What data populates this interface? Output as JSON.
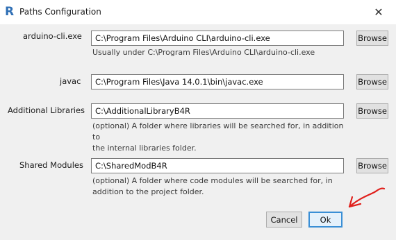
{
  "window": {
    "title": "Paths Configuration",
    "logo_text": "R",
    "close_glyph": "✕"
  },
  "rows": [
    {
      "label": "arduino-cli.exe",
      "value": "C:\\Program Files\\Arduino CLI\\arduino-cli.exe",
      "hint": [
        "Usually under C:\\Program Files\\Arduino CLI\\arduino-cli.exe"
      ],
      "browse_label": "Browse"
    },
    {
      "label": "javac",
      "value": "C:\\Program Files\\Java 14.0.1\\bin\\javac.exe",
      "hint": [],
      "browse_label": "Browse"
    },
    {
      "label": "Additional Libraries",
      "value": "C:\\AdditionalLibraryB4R",
      "hint": [
        "(optional) A folder where libraries will be searched for, in addition to",
        "the internal libraries folder."
      ],
      "browse_label": "Browse"
    },
    {
      "label": "Shared Modules",
      "value": "C:\\SharedModB4R",
      "hint": [
        "(optional) A folder where code modules will be searched for, in",
        "addition to the project folder."
      ],
      "browse_label": "Browse"
    }
  ],
  "footer": {
    "cancel_label": "Cancel",
    "ok_label": "Ok"
  },
  "colors": {
    "annotation_arrow": "#e0201c",
    "ok_border": "#3a8fd6",
    "logo": "#2f6fb5"
  }
}
